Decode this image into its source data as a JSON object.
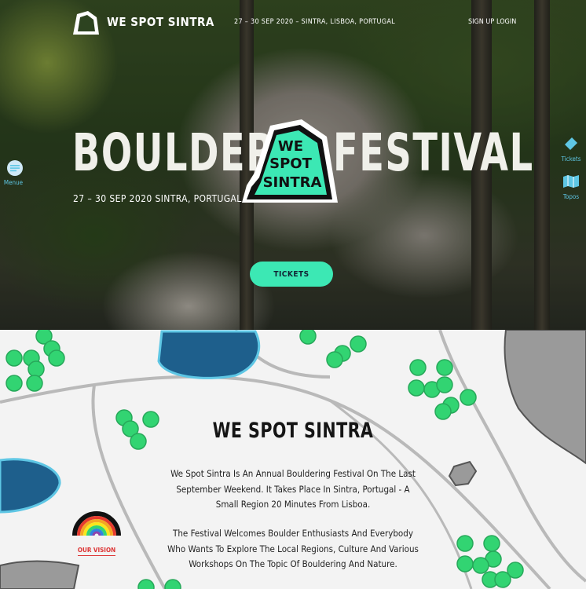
{
  "header": {
    "brand": "WE SPOT SINTRA",
    "event_info": "27 – 30 SEP 2020 – SINTRA, LISBOA, PORTUGAL",
    "signup": "SIGN UP",
    "login": "LOGIN"
  },
  "sidebar_left": {
    "menu_label": "Menue"
  },
  "sidebar_right": {
    "tickets_label": "Tickets",
    "topos_label": "Topos"
  },
  "hero": {
    "title_left": "BOULDER",
    "title_right": "FESTIVAL",
    "badge_lines": [
      "WE",
      "SPOT",
      "SINTRA"
    ],
    "subtitle": "27 – 30 SEP 2020 SINTRA, PORTUGAL",
    "tickets_button": "TICKETS"
  },
  "about": {
    "title": "WE SPOT SINTRA",
    "para1_l1": "We Spot Sintra Is An Annual Bouldering Festival On The Last",
    "para1_l2": "September Weekend. It Takes Place In Sintra, Portugal - A",
    "para1_l3": "Small Region 20 Minutes From Lisboa.",
    "para2_l1": "The Festival Welcomes Boulder Enthusiasts And Everybody",
    "para2_l2": "Who Wants To Explore The Local Regions, Culture And Various",
    "para2_l3": "Workshops On The Topic Of Bouldering And Nature.",
    "vision_label": "OUR VISION"
  },
  "colors": {
    "accent": "#3ce8b4",
    "map_water": "#1e5f8c",
    "map_water_edge": "#5ec6e4",
    "map_tree": "#32d472",
    "map_rock": "#9a9a9a",
    "sidebar_icon": "#5ec6e4"
  }
}
